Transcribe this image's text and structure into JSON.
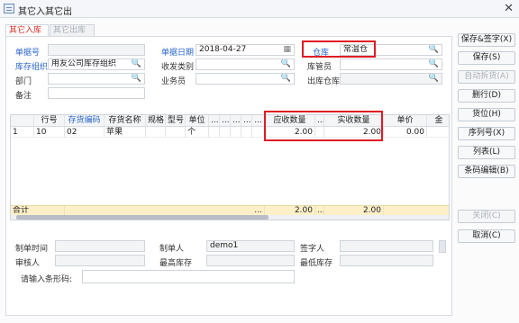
{
  "window": {
    "title": "其它入其它出",
    "close_glyph": "✕"
  },
  "tabs": [
    {
      "label": "其它入库单",
      "active": true
    },
    {
      "label": "其它出库单",
      "active": false
    }
  ],
  "header": {
    "doc_no": {
      "label": "单据号",
      "value": ""
    },
    "doc_date": {
      "label": "单据日期",
      "value": "2018-04-27"
    },
    "warehouse": {
      "label": "仓库",
      "value": "常温仓"
    },
    "stock_org": {
      "label": "库存组织",
      "value": "用友公司库存组织"
    },
    "receive_type": {
      "label": "收发类别",
      "value": ""
    },
    "keeper": {
      "label": "库管员",
      "value": ""
    },
    "dept": {
      "label": "部门",
      "value": ""
    },
    "salesman": {
      "label": "业务员",
      "value": ""
    },
    "out_warehouse": {
      "label": "出库仓库",
      "value": ""
    },
    "remark": {
      "label": "备注",
      "value": ""
    }
  },
  "grid": {
    "columns": [
      "行号",
      "存货编码",
      "存货名称",
      "规格",
      "型号",
      "单位",
      "...",
      "...",
      "...",
      "...",
      "...",
      "应收数量",
      "...",
      "实收数量",
      "单价",
      "金"
    ],
    "rows": [
      {
        "idx": "1",
        "line_no": "10",
        "code": "02",
        "name": "苹果",
        "spec": "",
        "model": "",
        "unit": "个",
        "due_qty": "2.00",
        "recv_qty": "2.00",
        "price": "0.00"
      }
    ],
    "total_label": "合计",
    "total_ellipsis": "...",
    "total_due": "2.00",
    "total_recv": "2.00"
  },
  "footer": {
    "make_time": {
      "label": "制单时间",
      "value": ""
    },
    "maker": {
      "label": "制单人",
      "value": "demo1"
    },
    "signer": {
      "label": "签字人",
      "value": ""
    },
    "auditor": {
      "label": "审核人",
      "value": ""
    },
    "max_stock": {
      "label": "最高库存",
      "value": ""
    },
    "min_stock": {
      "label": "最低库存",
      "value": ""
    },
    "barcode": {
      "label": "请输入条形码:",
      "value": ""
    }
  },
  "buttons": {
    "save_sign": "保存&签字(X)",
    "save": "保存(S)",
    "auto_split": "自动拆货(A)",
    "delete_row": "删行(D)",
    "location": "货位(H)",
    "serial": "序列号(X)",
    "list": "列表(L)",
    "barcode_edit": "条码编辑(B)",
    "close": "关闭(C)",
    "cancel": "取消(C)"
  },
  "icons": {
    "search": "🔍",
    "calendar": "▦"
  },
  "colors": {
    "accent_red": "#e01b24",
    "label_blue": "#2a66c9",
    "total_row": "#fdf0c8"
  }
}
